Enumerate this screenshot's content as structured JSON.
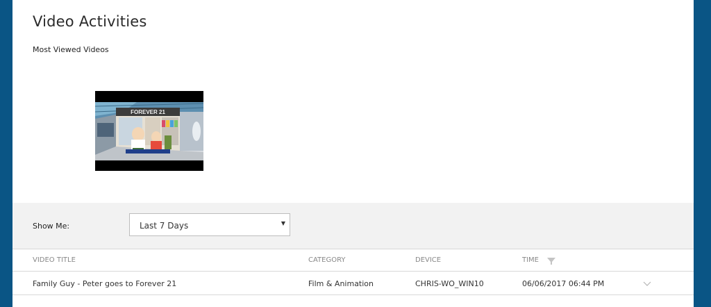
{
  "page": {
    "title": "Video Activities",
    "subtitle": "Most Viewed Videos"
  },
  "thumbnail": {
    "sign_text": "FOREVER 21"
  },
  "filter": {
    "label": "Show Me:",
    "selected": "Last 7 Days"
  },
  "table": {
    "headers": {
      "title": "VIDEO TITLE",
      "category": "CATEGORY",
      "device": "DEVICE",
      "time": "TIME"
    },
    "rows": [
      {
        "title": "Family Guy - Peter goes to Forever 21",
        "category": "Film & Animation",
        "device": "CHRIS-WO_WIN10",
        "time": "06/06/2017 06:44 PM"
      }
    ]
  },
  "icons": {
    "sort": "filter-funnel-icon",
    "expand": "chevron-down-icon",
    "select_caret": "caret-down-icon"
  },
  "colors": {
    "frame": "#0a5585",
    "panel": "#ffffff",
    "filter_bar": "#f2f2f2",
    "header_text": "#888888"
  }
}
